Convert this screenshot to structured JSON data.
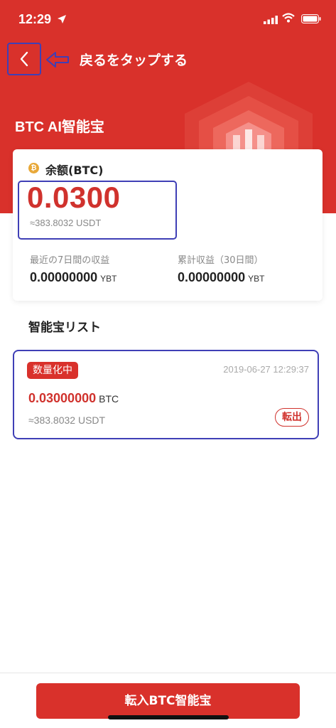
{
  "status_bar": {
    "time": "12:29"
  },
  "header": {
    "hint_text": "戻るをタップする",
    "title": "BTC AI智能宝"
  },
  "balance": {
    "coin_glyph": "₿",
    "label": "余额(BTC)",
    "amount": "0.0300",
    "usdt_equiv": "≈383.8032 USDT",
    "stats": [
      {
        "label": "最近の7日間の収益",
        "value": "0.00000000",
        "unit": "YBT"
      },
      {
        "label": "累計収益（30日間）",
        "value": "0.00000000",
        "unit": "YBT"
      }
    ]
  },
  "list": {
    "section_title": "智能宝リスト",
    "items": [
      {
        "status": "数量化中",
        "date": "2019-06-27 12:29:37",
        "amount": "0.03000000",
        "unit": "BTC",
        "usdt_equiv": "≈383.8032 USDT",
        "action_label": "転出"
      }
    ]
  },
  "footer": {
    "transfer_in_label": "転入BTC智能宝"
  },
  "colors": {
    "brand_red": "#d9312b",
    "annotation_blue": "#3f3fb6",
    "coin_gold": "#e8a838"
  }
}
